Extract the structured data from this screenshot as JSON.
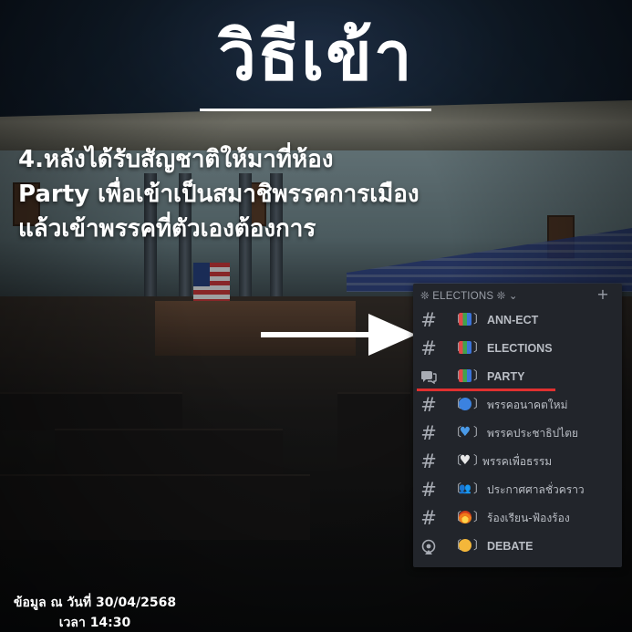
{
  "title": "วิธีเข้า",
  "instruction": {
    "lines": [
      "4.หลังได้รับสัญชาติให้มาที่ห้อง",
      "Party เพื่อเข้าเป็นสมาชิพรรคการเมือง",
      "แล้วเข้าพรรคที่ตัวเองต้องการ"
    ]
  },
  "footer": {
    "date_line": "ข้อมูล ณ วันที่ 30/04/2568",
    "time_line": "เวลา 14:30"
  },
  "discord": {
    "category": {
      "label": "❊ ELECTIONS ❊ ⌄",
      "plus_label": "+"
    },
    "channels": [
      {
        "icon": "hash-icon",
        "glyph": "#",
        "emoji": "books-emoji",
        "name": "ANN-ECT"
      },
      {
        "icon": "hash-icon",
        "glyph": "#",
        "emoji": "books-emoji",
        "name": "ELECTIONS"
      },
      {
        "icon": "forum-icon",
        "glyph": "",
        "emoji": "books-emoji",
        "name": "PARTY"
      },
      {
        "icon": "hash-icon",
        "glyph": "#",
        "emoji": "blue-circle-emoji",
        "name": "พรรคอนาคตใหม่"
      },
      {
        "icon": "hash-icon",
        "glyph": "#",
        "emoji": "blue-heart-emoji",
        "name": "พรรคประชาธิปไตย"
      },
      {
        "icon": "hash-icon",
        "glyph": "#",
        "emoji": "white-heart-emoji",
        "name": "พรรคเพื่อธรรม"
      },
      {
        "icon": "hash-icon",
        "glyph": "#",
        "emoji": "people-emoji",
        "name": "ประกาศศาลชั่วคราว"
      },
      {
        "icon": "hash-icon",
        "glyph": "#",
        "emoji": "fire-emoji",
        "name": "ร้องเรียน-ฟ้องร้อง"
      },
      {
        "icon": "stage-icon",
        "glyph": "",
        "emoji": "angry-face-emoji",
        "name": "DEBATE"
      }
    ]
  },
  "colors": {
    "panel_bg": "#22252b",
    "channel_text": "#b9bdc4",
    "highlight_underline": "#e03030"
  }
}
